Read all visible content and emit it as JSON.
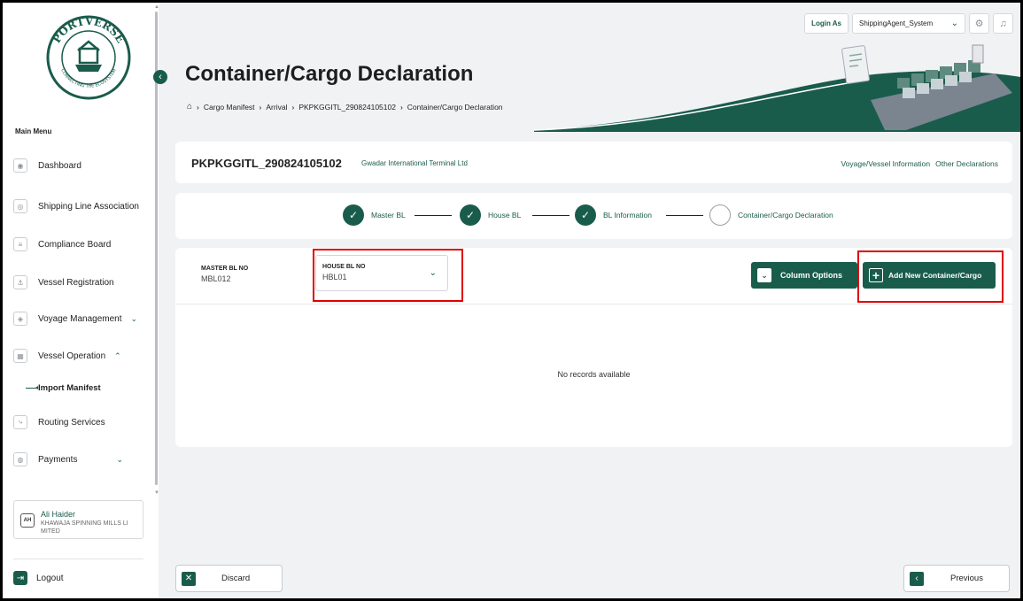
{
  "logo": {
    "brand": "PORTVERSE",
    "tagline": "CONNECTING THE ECOSYSTEM"
  },
  "sidebar": {
    "main_menu_label": "Main Menu",
    "items": [
      {
        "label": "Dashboard",
        "icon": "dashboard-icon"
      },
      {
        "label": "Shipping Line Association",
        "icon": "association-icon"
      },
      {
        "label": "Compliance Board",
        "icon": "document-icon"
      },
      {
        "label": "Vessel Registration",
        "icon": "ship-icon"
      },
      {
        "label": "Voyage Management",
        "icon": "location-icon",
        "chevron": "⌄"
      },
      {
        "label": "Vessel Operation",
        "icon": "cargo-icon",
        "chevron": "⌃"
      },
      {
        "label": "Routing Services",
        "icon": "route-icon"
      },
      {
        "label": "Payments",
        "icon": "payment-icon",
        "chevron": "⌄"
      }
    ],
    "sub_item": "Import Manifest",
    "user": {
      "initials": "AH",
      "name": "Ali Haider",
      "org": "KHAWAJA SPINNING MILLS LI MITED"
    },
    "logout": "Logout"
  },
  "topbar": {
    "login_as": "Login As",
    "agent": "ShippingAgent_System"
  },
  "header": {
    "title": "Container/Cargo Declaration",
    "breadcrumb": [
      "Cargo Manifest",
      "Arrival",
      "PKPKGGITL_290824105102",
      "Container/Cargo Declaration"
    ]
  },
  "info": {
    "ref_no": "PKPKGGITL_290824105102",
    "terminal": "Gwadar International Terminal Ltd",
    "link_voyage": "Voyage/Vessel Information",
    "link_other": "Other Declarations"
  },
  "stepper": [
    "Master BL",
    "House BL",
    "BL Information",
    "Container/Cargo Declaration"
  ],
  "table": {
    "master_label": "MASTER BL NO",
    "master_value": "MBL012",
    "house_label": "HOUSE BL NO",
    "house_value": "HBL01",
    "column_options": "Column Options",
    "add_new": "Add New Container/Cargo",
    "empty": "No records available"
  },
  "footer": {
    "discard": "Discard",
    "previous": "Previous"
  },
  "colors": {
    "brand": "#1a5c4c",
    "highlight": "#e00000"
  }
}
